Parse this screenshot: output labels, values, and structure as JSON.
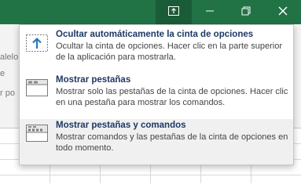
{
  "window": {
    "accent": "#217346",
    "buttons": [
      {
        "name": "ribbon-display-options",
        "icon": "ribbon-display-options-icon"
      },
      {
        "name": "minimize",
        "icon": "minimize-icon"
      },
      {
        "name": "restore",
        "icon": "restore-icon"
      },
      {
        "name": "close",
        "icon": "close-icon"
      }
    ]
  },
  "background": {
    "fragments": [
      "alelo",
      "e",
      "r po"
    ]
  },
  "ribbon_menu": {
    "options": [
      {
        "title": "Ocultar automáticamente la cinta de opciones",
        "description": "Ocultar la cinta de opciones. Hacer clic en la parte superior de la aplicación para mostrarla.",
        "icon": "auto-hide-ribbon-icon"
      },
      {
        "title": "Mostrar pestañas",
        "description": "Mostrar solo las pestañas de la cinta de opciones. Hacer clic en una pestaña para mostrar los comandos.",
        "icon": "show-tabs-icon"
      },
      {
        "title": "Mostrar pestañas y comandos",
        "description": "Mostrar comandos y las pestañas de la cinta de opciones en todo momento.",
        "icon": "show-tabs-and-commands-icon",
        "highlighted": true
      }
    ]
  }
}
